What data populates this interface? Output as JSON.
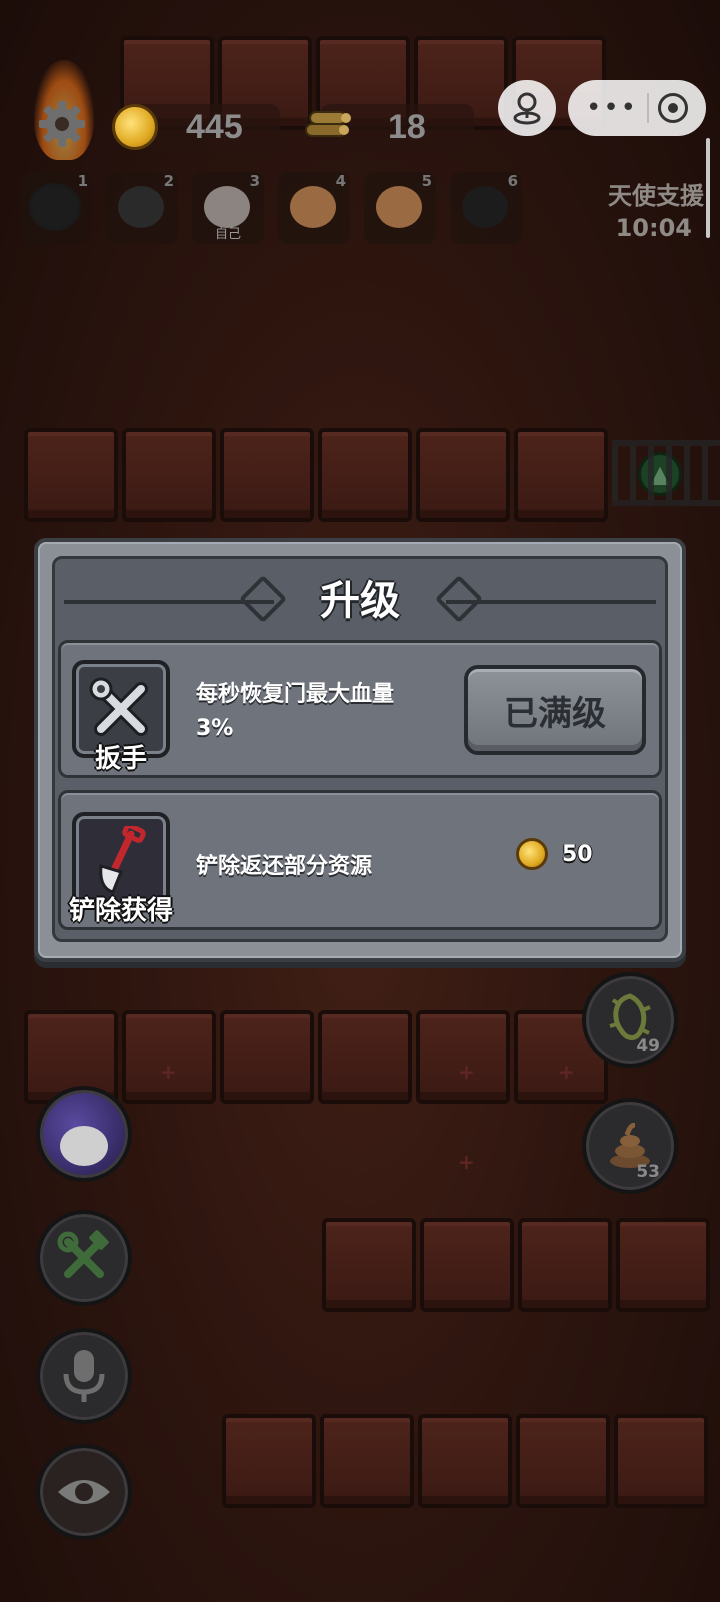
{
  "hud": {
    "coins": "445",
    "wood": "18",
    "support_label": "天使支援",
    "support_time": "10:04"
  },
  "players": [
    {
      "num": "1",
      "tag": ""
    },
    {
      "num": "2",
      "tag": ""
    },
    {
      "num": "3",
      "tag": "自己"
    },
    {
      "num": "4",
      "tag": ""
    },
    {
      "num": "5",
      "tag": ""
    },
    {
      "num": "6",
      "tag": ""
    }
  ],
  "dialog": {
    "title": "升级",
    "upgrade": {
      "item_name": "扳手",
      "description": "每秒恢复门最大血量",
      "value": "3%",
      "button_label": "已满级"
    },
    "remove": {
      "item_name": "铲除获得",
      "description": "铲除返还部分资源",
      "cost": "50"
    }
  },
  "side_buttons": {
    "thorns_count": "49",
    "poop_count": "53"
  },
  "colors": {
    "dialog_frame": "#8b9097",
    "dialog_panel": "#5a5f67",
    "button": "#7f848b",
    "coin": "#e0a922"
  }
}
